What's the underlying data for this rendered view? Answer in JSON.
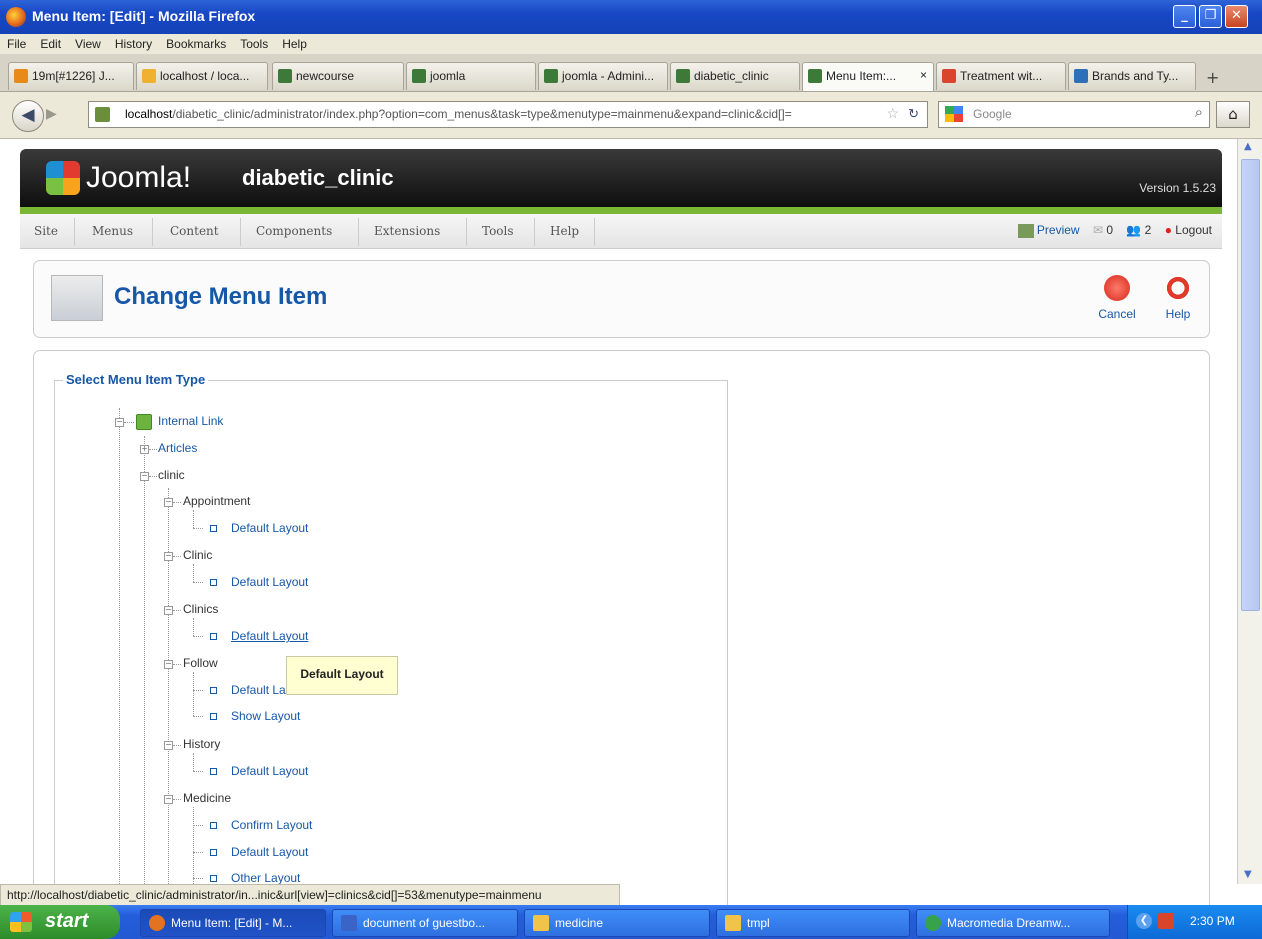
{
  "window": {
    "title": "Menu Item: [Edit] - Mozilla Firefox"
  },
  "menubar": [
    "File",
    "Edit",
    "View",
    "History",
    "Bookmarks",
    "Tools",
    "Help"
  ],
  "tabs": [
    {
      "label": "19m[#1226] J...",
      "color": "#e88a1a"
    },
    {
      "label": "localhost / loca...",
      "color": "#f0b030"
    },
    {
      "label": "newcourse",
      "color": "#3d7a3a"
    },
    {
      "label": "joomla",
      "color": "#3d7a3a"
    },
    {
      "label": "joomla - Admini...",
      "color": "#3d7a3a"
    },
    {
      "label": "diabetic_clinic",
      "color": "#3d7a3a"
    },
    {
      "label": "Menu Item:...",
      "color": "#3d7a3a"
    },
    {
      "label": "Treatment wit...",
      "color": "#d8442c"
    },
    {
      "label": "Brands and Ty...",
      "color": "#2f6fb7"
    }
  ],
  "tab_close": "×",
  "tab_new": "+",
  "nav": {
    "url_host": "localhost",
    "url_rest": "/diabetic_clinic/administrator/index.php?option=com_menus&task=type&menutype=mainmenu&expand=clinic&cid[]=",
    "search_placeholder": "Google"
  },
  "joomla": {
    "brand": "Joomla!",
    "site_name": "diabetic_clinic",
    "version": "Version 1.5.23",
    "menu": [
      "Site",
      "Menus",
      "Content",
      "Components",
      "Extensions",
      "Tools",
      "Help"
    ],
    "right": {
      "preview": "Preview",
      "messages": "0",
      "users": "2",
      "logout": "Logout"
    }
  },
  "toolbar": {
    "title": "Change Menu Item",
    "cancel": "Cancel",
    "help": "Help"
  },
  "legend": "Select Menu Item Type",
  "tree": {
    "internal_link": "Internal Link",
    "articles": "Articles",
    "clinic": "clinic",
    "appointment": "Appointment",
    "appointment_default": "Default Layout",
    "clinic_view": "Clinic",
    "clinic_default": "Default Layout",
    "clinics": "Clinics",
    "clinics_default": "Default Layout",
    "follow": "Follow",
    "follow_default": "Default La",
    "follow_show": "Show Layout",
    "history": "History",
    "history_default": "Default Layout",
    "medicine": "Medicine",
    "medicine_confirm": "Confirm Layout",
    "medicine_default": "Default Layout",
    "medicine_other": "Other Layout"
  },
  "tooltip": "Default Layout",
  "statusbar": "http://localhost/diabetic_clinic/administrator/in...inic&url[view]=clinics&cid[]=53&menutype=mainmenu",
  "taskbar": {
    "start": "start",
    "tasks": [
      {
        "label": "Menu Item: [Edit] - M...",
        "color": "#e3731e"
      },
      {
        "label": "document of guestbo...",
        "color": "#3a64c8"
      },
      {
        "label": "medicine",
        "color": "#f2c34a"
      },
      {
        "label": "tmpl",
        "color": "#f2c34a"
      },
      {
        "label": "Macromedia Dreamw...",
        "color": "#36a34a"
      }
    ],
    "clock": "2:30 PM"
  }
}
